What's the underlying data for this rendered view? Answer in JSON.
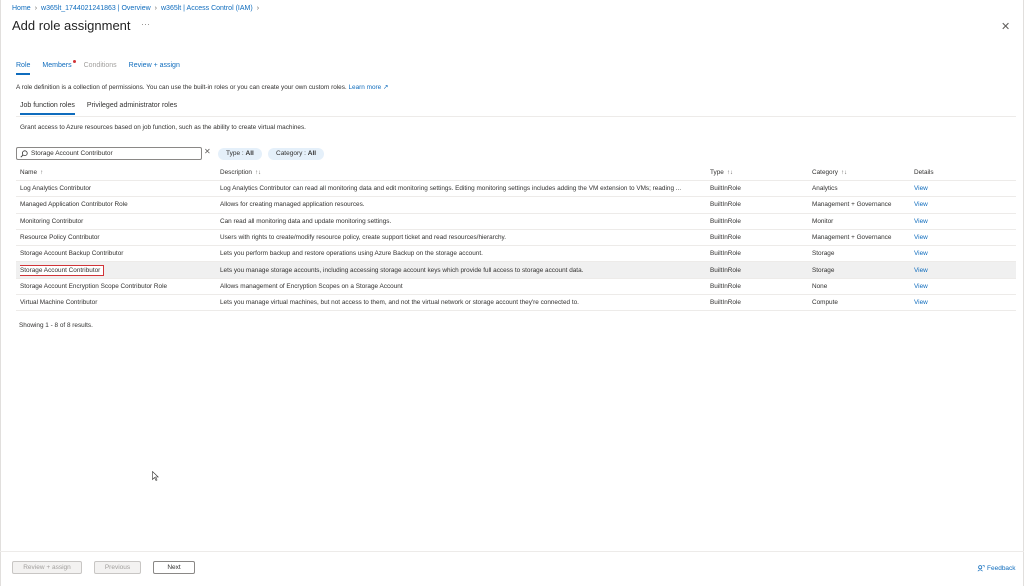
{
  "breadcrumb": [
    "Home",
    "w365lt_1744021241863 | Overview",
    "w365lt | Access Control (IAM)"
  ],
  "title": "Add role assignment",
  "title_more": "···",
  "tabs": [
    {
      "label": "Role",
      "state": "active"
    },
    {
      "label": "Members",
      "state": "normal"
    },
    {
      "label": "Conditions",
      "state": "disabled"
    },
    {
      "label": "Review + assign",
      "state": "normal"
    }
  ],
  "intro_text": "A role definition is a collection of permissions. You can use the built-in roles or you can create your own custom roles.",
  "intro_link": "Learn more",
  "subtabs": [
    "Job function roles",
    "Privileged administrator roles"
  ],
  "grant_text": "Grant access to Azure resources based on job function, such as the ability to create virtual machines.",
  "search_value": "Storage Account Contributor",
  "filters": {
    "type_label": "Type : ",
    "type_value": "All",
    "category_label": "Category : ",
    "category_value": "All"
  },
  "table": {
    "headers": [
      "Name",
      "Description",
      "Type",
      "Category",
      "Details"
    ],
    "rows": [
      {
        "name": "Log Analytics Contributor",
        "description": "Log Analytics Contributor can read all monitoring data and edit monitoring settings. Editing monitoring settings includes adding the VM extension to VMs; reading ...",
        "type": "BuiltInRole",
        "category": "Analytics",
        "details": "View"
      },
      {
        "name": "Managed Application Contributor Role",
        "description": "Allows for creating managed application resources.",
        "type": "BuiltInRole",
        "category": "Management + Governance",
        "details": "View"
      },
      {
        "name": "Monitoring Contributor",
        "description": "Can read all monitoring data and update monitoring settings.",
        "type": "BuiltInRole",
        "category": "Monitor",
        "details": "View"
      },
      {
        "name": "Resource Policy Contributor",
        "description": "Users with rights to create/modify resource policy, create support ticket and read resources/hierarchy.",
        "type": "BuiltInRole",
        "category": "Management + Governance",
        "details": "View"
      },
      {
        "name": "Storage Account Backup Contributor",
        "description": "Lets you perform backup and restore operations using Azure Backup on the storage account.",
        "type": "BuiltInRole",
        "category": "Storage",
        "details": "View"
      },
      {
        "name": "Storage Account Contributor",
        "description": "Lets you manage storage accounts, including accessing storage account keys which provide full access to storage account data.",
        "type": "BuiltInRole",
        "category": "Storage",
        "details": "View"
      },
      {
        "name": "Storage Account Encryption Scope Contributor Role",
        "description": "Allows management of Encryption Scopes on a Storage Account",
        "type": "BuiltInRole",
        "category": "None",
        "details": "View"
      },
      {
        "name": "Virtual Machine Contributor",
        "description": "Lets you manage virtual machines, but not access to them, and not the virtual network or storage account they're connected to.",
        "type": "BuiltInRole",
        "category": "Compute",
        "details": "View"
      }
    ],
    "selected_index": 5
  },
  "showing_text": "Showing 1 - 8 of 8 results.",
  "footer": {
    "review_assign": "Review + assign",
    "previous": "Previous",
    "next": "Next",
    "feedback": "Feedback"
  },
  "colors": {
    "accent": "#0f6cbd",
    "selection_outline": "#d13438"
  }
}
